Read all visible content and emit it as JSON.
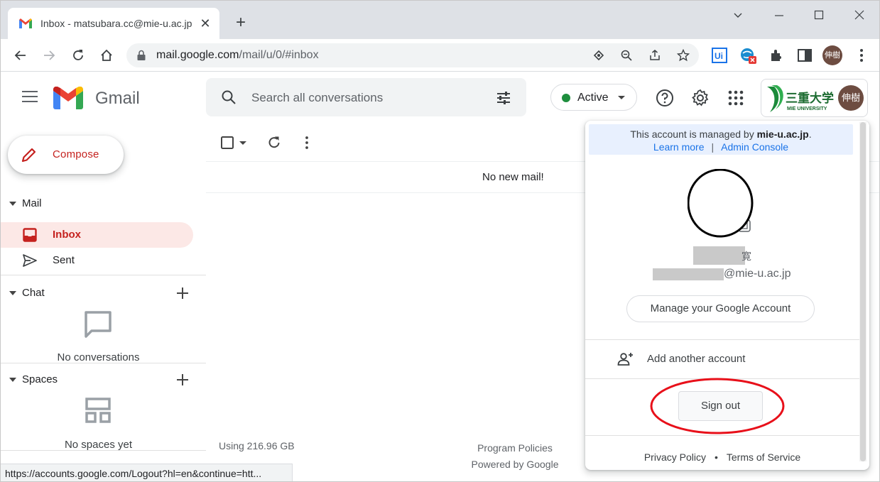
{
  "browser": {
    "tab_title": "Inbox - matsubara.cc@mie-u.ac.jp",
    "url_host": "mail.google.com",
    "url_path": "/mail/u/0/#inbox"
  },
  "header": {
    "app_name": "Gmail",
    "search_placeholder": "Search all conversations",
    "status_label": "Active",
    "status_color": "#1e8e3e",
    "org_logo_text": "三重大学",
    "org_logo_sub": "MIE UNIVERSITY",
    "avatar_text": "伸樹"
  },
  "sidebar": {
    "compose_label": "Compose",
    "mail_section": "Mail",
    "items": [
      {
        "label": "Inbox",
        "icon": "inbox-icon",
        "selected": true
      },
      {
        "label": "Sent",
        "icon": "send-icon",
        "selected": false
      }
    ],
    "chat_section": "Chat",
    "chat_empty": "No conversations",
    "spaces_section": "Spaces",
    "spaces_empty": "No spaces yet"
  },
  "main": {
    "empty_message": "No new mail!",
    "storage": "Using 216.96 GB",
    "footer_links": [
      "Program Policies",
      "Powered by Google"
    ]
  },
  "status_bar_url": "https://accounts.google.com/Logout?hl=en&continue=htt...",
  "popup": {
    "managed_prefix": "This account is managed by ",
    "managed_domain": "mie-u.ac.jp",
    "managed_suffix": ".",
    "learn_more": "Learn more",
    "admin_console": "Admin Console",
    "name_suffix": "寛",
    "email_domain": "@mie-u.ac.jp",
    "manage_account": "Manage your Google Account",
    "add_account": "Add another account",
    "sign_out": "Sign out",
    "privacy": "Privacy Policy",
    "terms": "Terms of Service",
    "separator": "•",
    "link_separator": "|",
    "accent_color": "#1a73e8",
    "highlight_color": "#e8101a"
  }
}
